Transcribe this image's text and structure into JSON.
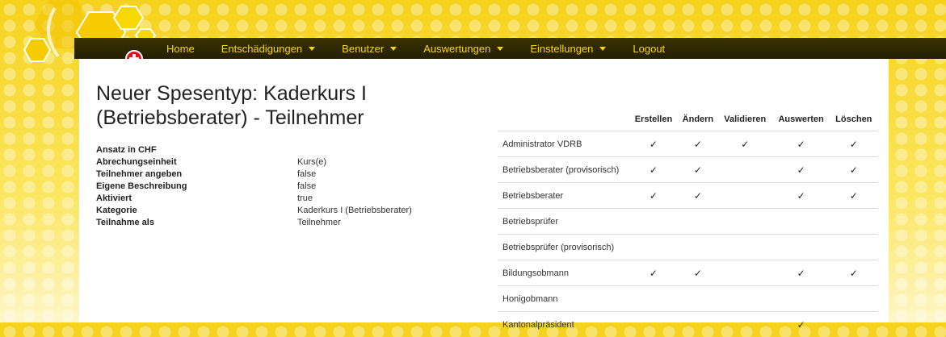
{
  "nav": {
    "items": [
      {
        "label": "Home",
        "dropdown": false
      },
      {
        "label": "Entschädigungen",
        "dropdown": true
      },
      {
        "label": "Benutzer",
        "dropdown": true
      },
      {
        "label": "Auswertungen",
        "dropdown": true
      },
      {
        "label": "Einstellungen",
        "dropdown": true
      },
      {
        "label": "Logout",
        "dropdown": false
      }
    ]
  },
  "page": {
    "title": "Neuer Spesentyp: Kaderkurs I (Betriebsberater) - Teilnehmer"
  },
  "properties": [
    {
      "label": "Ansatz in CHF",
      "value": ""
    },
    {
      "label": "Abrechungseinheit",
      "value": "Kurs(e)"
    },
    {
      "label": "Teilnehmer angeben",
      "value": "false"
    },
    {
      "label": "Eigene Beschreibung",
      "value": "false"
    },
    {
      "label": "Aktiviert",
      "value": "true"
    },
    {
      "label": "Kategorie",
      "value": "Kaderkurs I (Betriebsberater)"
    },
    {
      "label": "Teilnahme als",
      "value": "Teilnehmer"
    }
  ],
  "permissions": {
    "columns": [
      "Erstellen",
      "Ändern",
      "Validieren",
      "Auswerten",
      "Löschen"
    ],
    "check_symbol": "✓",
    "rows": [
      {
        "role": "Administrator VDRB",
        "checks": [
          true,
          true,
          true,
          true,
          true
        ]
      },
      {
        "role": "Betriebsberater (provisorisch)",
        "checks": [
          true,
          true,
          false,
          true,
          true
        ]
      },
      {
        "role": "Betriebsberater",
        "checks": [
          true,
          true,
          false,
          true,
          true
        ]
      },
      {
        "role": "Betriebsprüfer",
        "checks": [
          false,
          false,
          false,
          false,
          false
        ]
      },
      {
        "role": "Betriebsprüfer (provisorisch)",
        "checks": [
          false,
          false,
          false,
          false,
          false
        ]
      },
      {
        "role": "Bildungsobmann",
        "checks": [
          true,
          true,
          false,
          true,
          true
        ]
      },
      {
        "role": "Honigobmann",
        "checks": [
          false,
          false,
          false,
          false,
          false
        ]
      },
      {
        "role": "Kantonalpräsident",
        "checks": [
          false,
          false,
          false,
          true,
          false
        ]
      }
    ]
  },
  "colors": {
    "nav_text": "#f7d60e",
    "nav_bg": "#2e2800",
    "honey": "#f5d21a"
  }
}
